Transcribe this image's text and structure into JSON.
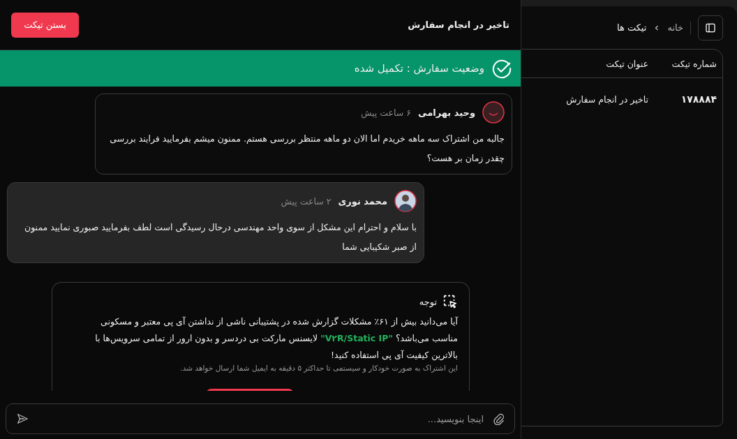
{
  "chat": {
    "title": "تاخیر در انجام سفارش",
    "close_button": "بستن تیکت",
    "status": {
      "text": "وضعیت سفارش : تکمیل شده"
    },
    "messages": [
      {
        "kind": "customer",
        "author": "وحید بهرامی",
        "time": "۶ ساعت پیش",
        "text": "جالبه من اشتراک سه ماهه خریدم اما الان دو ماهه منتظر بررسی هستم. ممنون میشم بفرمایید فرایند بررسی چقدر زمان بر هست؟"
      },
      {
        "kind": "agent",
        "author": "محمد نوری",
        "time": "۲ ساعت پیش",
        "text": "با سلام و احترام این مشکل از سوی واحد مهندسی درحال رسیدگی است لطف بفرمایید صبوری نمایید ممنون از صبر شکیبایی شما"
      }
    ],
    "notice": {
      "title": "توجه",
      "text_parts": [
        {
          "text": "آیا می‌دانید بیش از ۶۱٪ مشکلات گزارش شده در پشتیبانی ناشی از نداشتن آی پی معتبر و مسکونی مناسب می‌باشد؟ ",
          "highlight": false
        },
        {
          "text": "\"V۲R/Static IP\"",
          "highlight": true
        },
        {
          "text": " لایسنس مارکت بی دردسر و بدون ارور از تمامی سرویس‌ها با بالاترین کیفیت آی پی استفاده کنید!",
          "highlight": false
        }
      ],
      "footnote": "این اشتراک به صورت خودکار و سیستمی تا حداکثر ۵ دقیقه به ایمیل شما ارسال خواهد شد."
    },
    "composer": {
      "placeholder": "اینجا بنویسید..."
    }
  },
  "tickets": {
    "breadcrumb": [
      {
        "label": "خانه",
        "current": false
      },
      {
        "label": "تیکت ها",
        "current": true
      }
    ],
    "table": {
      "columns": [
        "شماره تیکت",
        "عنوان تیکت"
      ],
      "rows": [
        [
          "۱۷۸۸۸۴",
          "تاخیر در انجام سفارش"
        ]
      ]
    }
  }
}
